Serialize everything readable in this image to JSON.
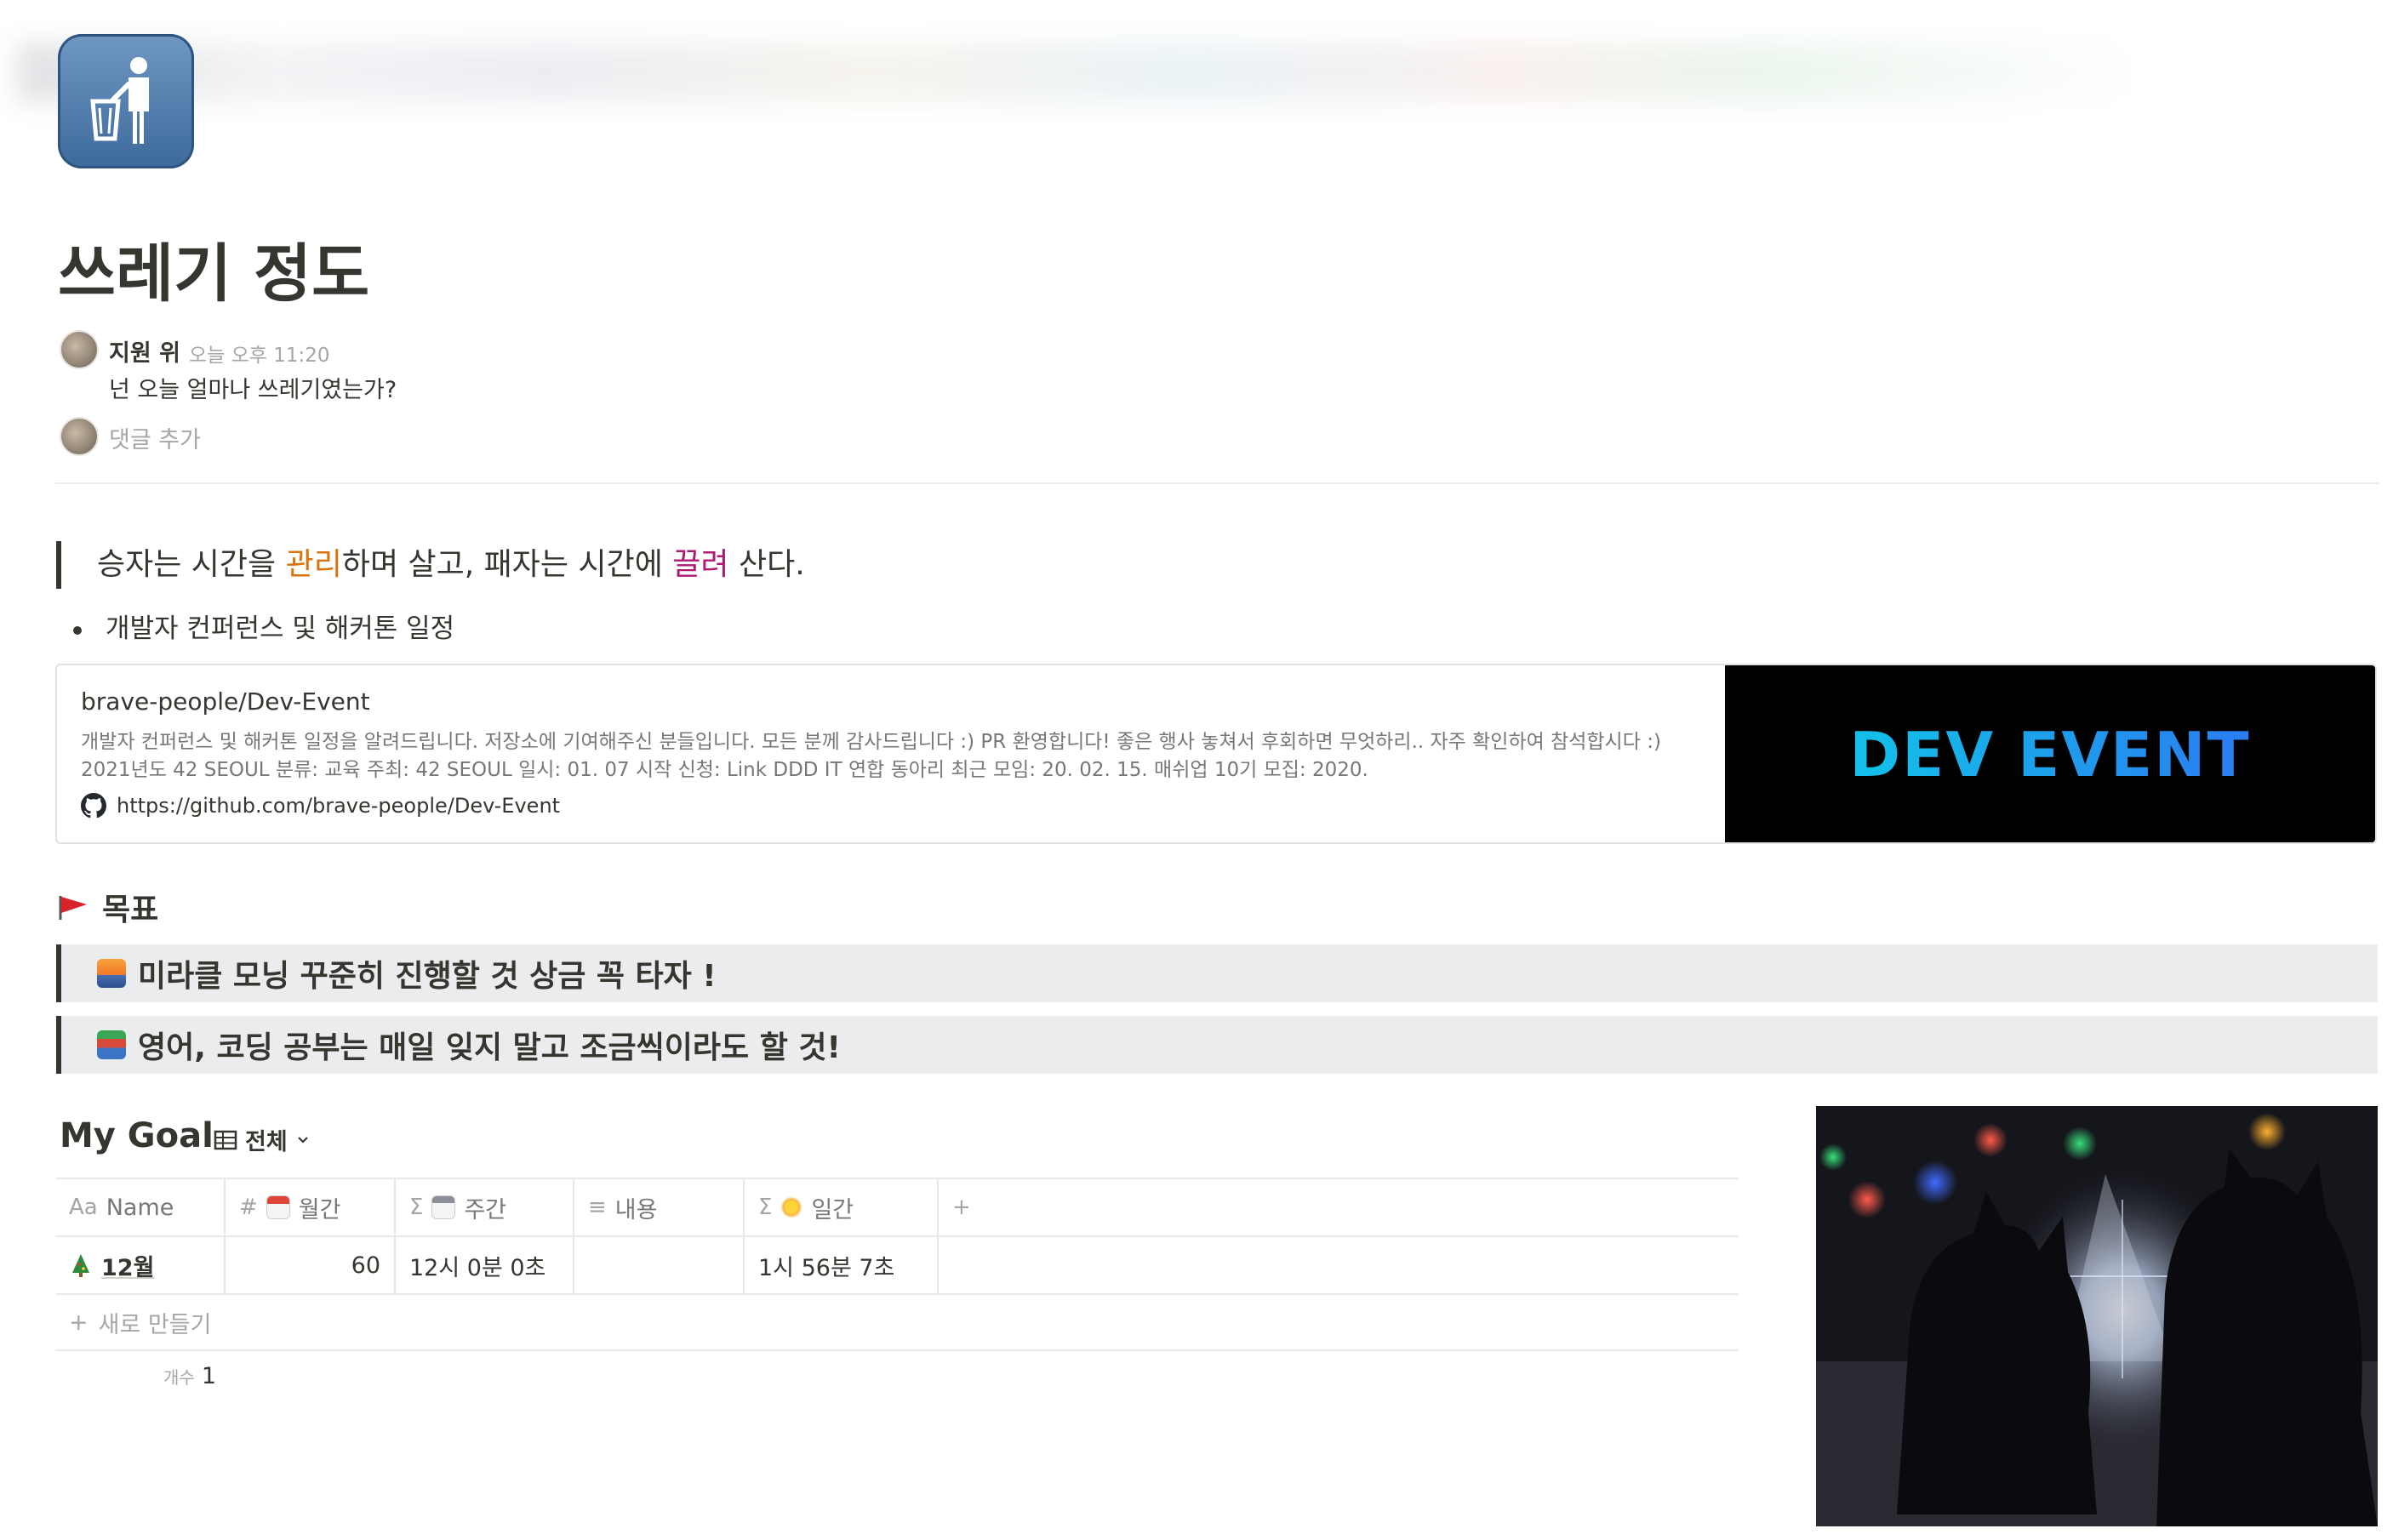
{
  "page": {
    "icon": "trash-person-icon",
    "title": "쓰레기 정도"
  },
  "comment": {
    "author": "지원 위",
    "time": "오늘 오후 11:20",
    "text": "넌 오늘 얼마나 쓰레기였는가?",
    "add_placeholder": "댓글 추가"
  },
  "quote": {
    "part1": "승자는 시간을 ",
    "highlight1": "관리",
    "part2": "하며 살고, 패자는 시간에 ",
    "highlight2": "끌려",
    "part3": " 산다.",
    "highlight1_color": "#d9730d",
    "highlight2_color": "#ad1a72"
  },
  "bullet": {
    "text": "개발자 컨퍼런스 및 해커톤 일정"
  },
  "bookmark": {
    "title": "brave-people/Dev-Event",
    "description": "개발자 컨퍼런스 및 해커톤 일정을 알려드립니다. 저장소에 기여해주신 분들입니다. 모든 분께 감사드립니다 :) PR 환영합니다! 좋은 행사 놓쳐서 후회하면 무엇하리.. 자주 확인하여 참석합시다 :) 2021년도 42 SEOUL 분류: 교육 주최: 42 SEOUL 일시: 01. 07 시작 신청: Link DDD IT 연합 동아리 최근 모임: 20. 02. 15. 매쉬업 10기 모집: 2020.",
    "url": "https://github.com/brave-people/Dev-Event",
    "image_text": "DEV EVENT",
    "url_icon": "github-icon"
  },
  "goal_section": {
    "icon": "red-flag-icon",
    "title": "목표",
    "callouts": [
      {
        "icon": "sunrise-icon",
        "text": "미라클 모닝 꾸준히 진행할 것  상금 꼭 타자 !"
      },
      {
        "icon": "books-icon",
        "text": "영어, 코딩 공부는 매일 잊지 말고 조금씩이라도 할 것!"
      }
    ]
  },
  "database": {
    "title": "My Goal",
    "view_label": "전체",
    "columns": [
      {
        "icon": "Aa",
        "label": "Name"
      },
      {
        "icon": "#",
        "label": "월간"
      },
      {
        "icon": "Σ",
        "label": "주간"
      },
      {
        "icon": "≡",
        "label": "내용"
      },
      {
        "icon": "Σ",
        "label": "일간"
      }
    ],
    "add_column": "+",
    "rows": [
      {
        "name": "12월",
        "monthly": "60",
        "weekly": "12시 0분 0초",
        "content": "",
        "daily": "1시 56분 7초"
      }
    ],
    "new_row_label": "새로 만들기",
    "count_label": "개수",
    "count_value": "1"
  },
  "photo": {
    "description_icon": "christmas-photo"
  },
  "colors": {
    "text": "#37352f",
    "muted": "#787774",
    "callout_bg": "#ebeced"
  }
}
